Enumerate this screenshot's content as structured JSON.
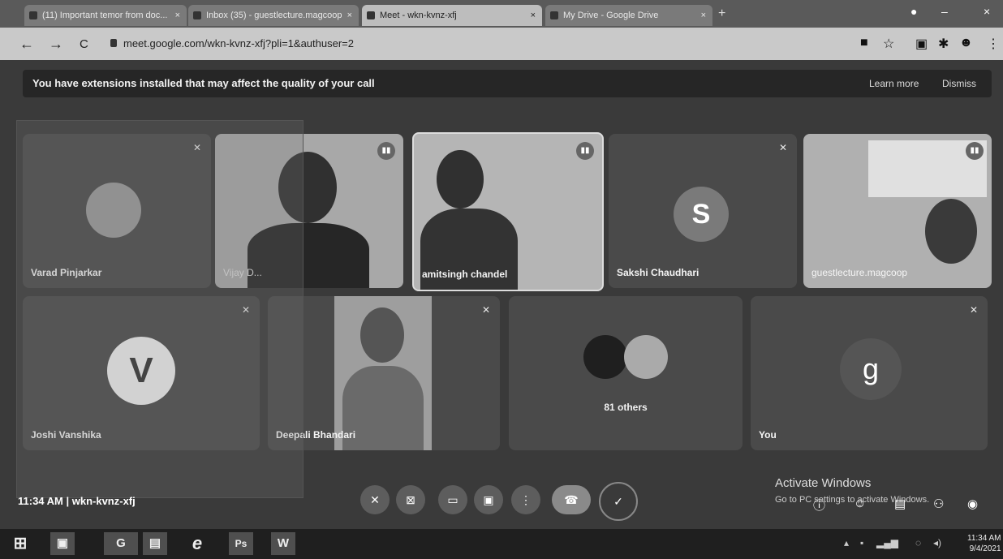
{
  "browser": {
    "tabs": [
      {
        "label": "(11) Important temor from doc..."
      },
      {
        "label": "Inbox (35) - guestlecture.magcoop"
      },
      {
        "label": "Meet - wkn-kvnz-xfj"
      },
      {
        "label": "My Drive - Google Drive"
      }
    ],
    "new_tab": "+",
    "back": "←",
    "forward": "→",
    "reload": "C",
    "url": "meet.google.com/wkn-kvnz-xfj?pli=1&authuser=2"
  },
  "meet": {
    "banner": {
      "message": "You have extensions installed that may affect the quality of your call",
      "learn_more": "Learn more",
      "dismiss": "Dismiss"
    },
    "tiles": [
      {
        "name": "Varad Pinjarkar"
      },
      {
        "name": "Vijay D..."
      },
      {
        "name": "amitsingh chandel"
      },
      {
        "name": "Sakshi Chaudhari",
        "avatar_letter": "S"
      },
      {
        "name": "guestlecture.magcoop"
      },
      {
        "name": "Joshi Vanshika",
        "avatar_letter": "V"
      },
      {
        "name": "Deepali Bhandari"
      },
      {
        "name": "81 others"
      },
      {
        "name": "You",
        "avatar_letter": "g"
      }
    ],
    "meeting_info": "11:34 AM  |  wkn-kvnz-xfj",
    "activate_title": "Activate Windows",
    "activate_sub": "Go to PC settings to activate Windows."
  },
  "taskbar": {
    "items": [
      "⊞",
      "▣",
      "G",
      "▤",
      "e",
      "Ps",
      "W"
    ],
    "time": "11:34 AM",
    "date": "9/4/2021"
  },
  "colors": {
    "end_call": "#8a8a8a",
    "tile_bg": "#4a4a4a"
  }
}
